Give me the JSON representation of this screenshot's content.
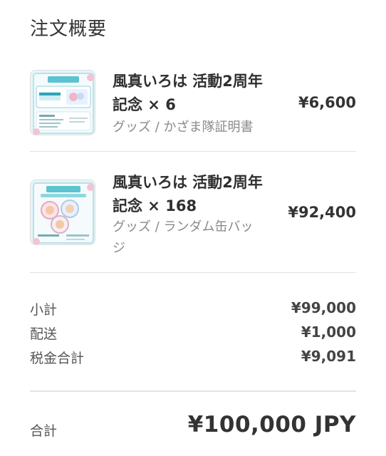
{
  "summary": {
    "title": "注文概要"
  },
  "items": [
    {
      "name_line1": "風真いろは 活動2周年",
      "name_line2": "記念 × 6",
      "variant": "グッズ / かざま隊証明書",
      "price": "¥6,600",
      "thumbnail_icon": "certificate-product-image"
    },
    {
      "name_line1": "風真いろは 活動2周年",
      "name_line2": "記念 × 168",
      "variant_line1": "グッズ / ランダム缶バッ",
      "variant_line2": "ジ",
      "price": "¥92,400",
      "thumbnail_icon": "badge-product-image"
    }
  ],
  "totals": {
    "subtotal_label": "小計",
    "subtotal_value": "¥99,000",
    "shipping_label": "配送",
    "shipping_value": "¥1,000",
    "tax_label": "税金合計",
    "tax_value": "¥9,091",
    "total_label": "合計",
    "total_value": "¥100,000 JPY"
  }
}
